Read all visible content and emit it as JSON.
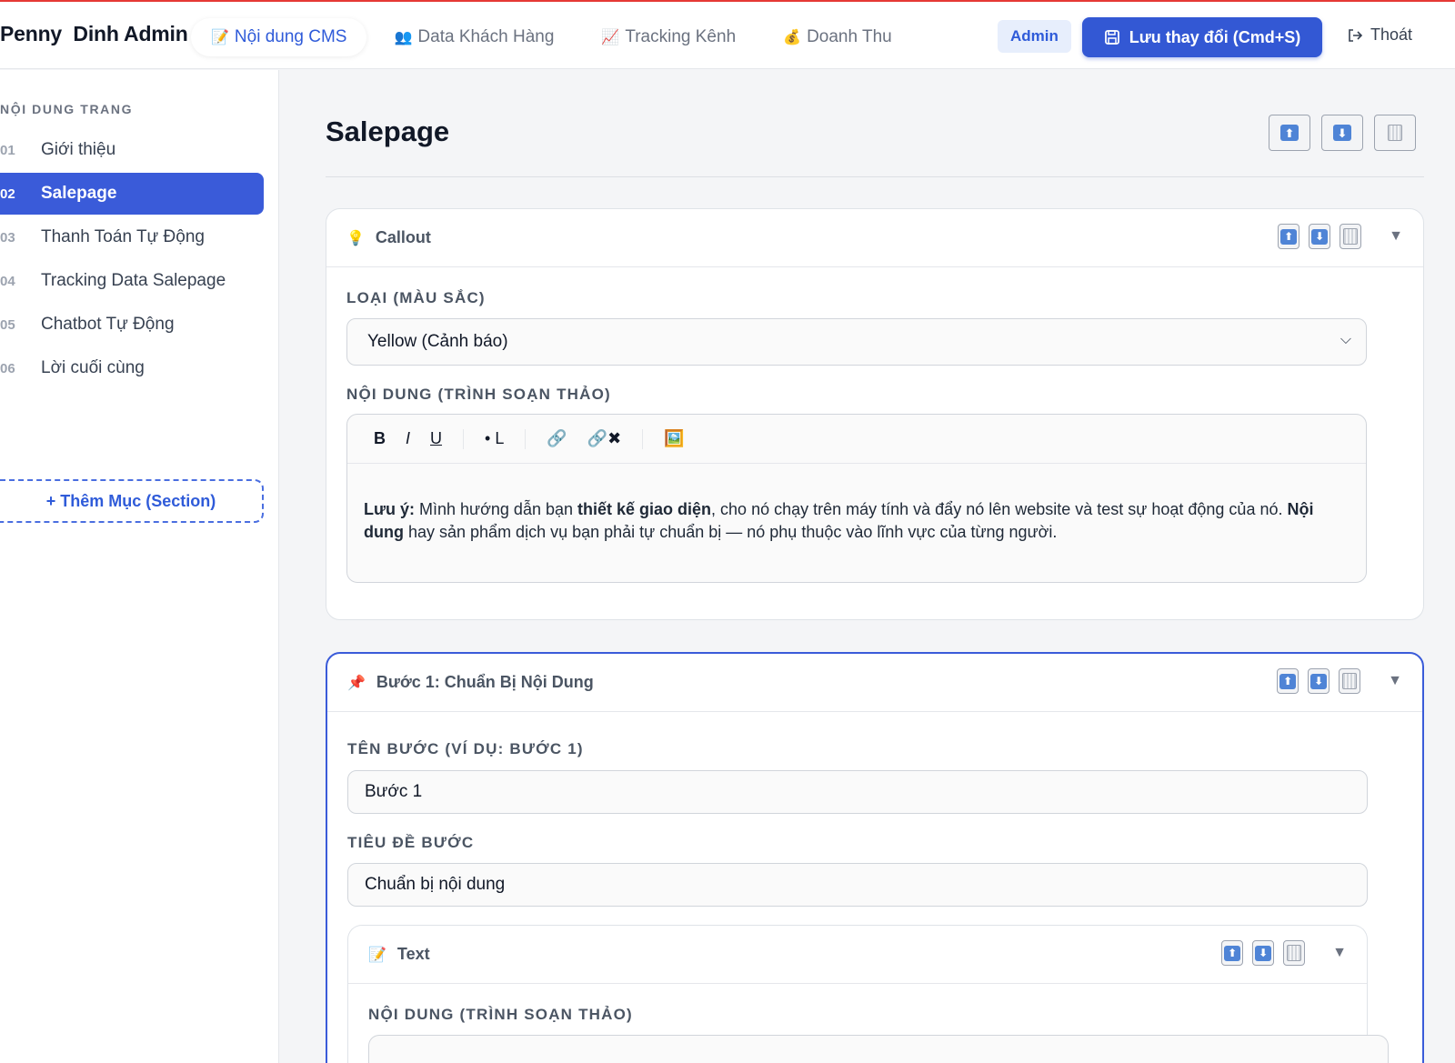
{
  "brand": "Penny  Dinh Admin",
  "nav": [
    {
      "icon": "📝",
      "label": "Nội dung CMS"
    },
    {
      "icon": "👥",
      "label": "Data Khách Hàng"
    },
    {
      "icon": "📈",
      "label": "Tracking Kênh"
    },
    {
      "icon": "💰",
      "label": "Doanh Thu"
    }
  ],
  "header": {
    "admin_badge": "Admin",
    "save_label": "Lưu thay đổi (Cmd+S)",
    "logout_label": "Thoát"
  },
  "sidebar": {
    "heading": "NỘI DUNG TRANG",
    "items": [
      {
        "num": "01",
        "label": "Giới thiệu"
      },
      {
        "num": "02",
        "label": "Salepage"
      },
      {
        "num": "03",
        "label": "Thanh Toán Tự Động"
      },
      {
        "num": "04",
        "label": "Tracking Data Salepage"
      },
      {
        "num": "05",
        "label": "Chatbot Tự Động"
      },
      {
        "num": "06",
        "label": "Lời cuối cùng"
      }
    ],
    "add_section": "+ Thêm Mục (Section)"
  },
  "main": {
    "title": "Salepage",
    "callout": {
      "icon": "💡",
      "title": "Callout",
      "type_label": "LOẠI (MÀU SẮC)",
      "type_value": "Yellow (Cảnh báo)",
      "content_label": "NỘI DUNG (TRÌNH SOẠN THẢO)",
      "content": {
        "b1": "Lưu ý:",
        "t1": " Mình hướng dẫn bạn ",
        "b2": "thiết kế giao diện",
        "t2": ", cho nó chạy trên máy tính và đẩy nó lên website và test sự hoạt động của nó. ",
        "b3": "Nội dung",
        "t3": " hay sản phẩm dịch vụ bạn phải tự chuẩn bị — nó phụ thuộc vào lĩnh vực của từng người."
      }
    },
    "step": {
      "icon": "📌",
      "title": "Bước 1: Chuẩn Bị Nội Dung",
      "name_label": "TÊN BƯỚC (VÍ DỤ: BƯỚC 1)",
      "name_value": "Bước 1",
      "heading_label": "TIÊU ĐỀ BƯỚC",
      "heading_value": "Chuẩn bị nội dung",
      "text_block": {
        "icon": "📝",
        "title": "Text",
        "content_label": "NỘI DUNG (TRÌNH SOẠN THẢO)"
      }
    }
  },
  "toolbar": {
    "bold": "B",
    "italic": "I",
    "underline": "U",
    "list": "• L",
    "link": "🔗",
    "unlink": "🔗✖",
    "image": "🖼️"
  },
  "icons": {
    "up": "⬆",
    "down": "⬇",
    "caret": "▼",
    "chevron": "⌵"
  },
  "colors": {
    "accent": "#3358d4",
    "top_border": "#e53935"
  }
}
